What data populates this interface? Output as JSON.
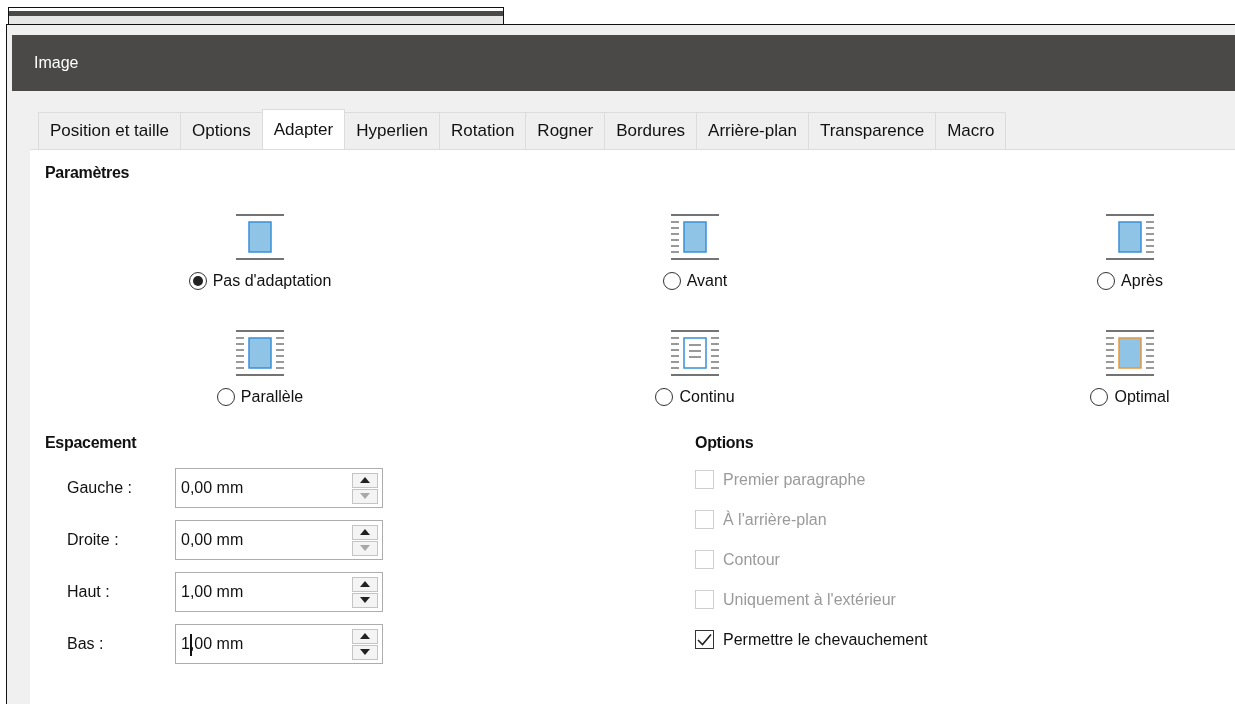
{
  "window": {
    "title": "Image"
  },
  "tabs": [
    {
      "label": "Position et taille",
      "selected": false
    },
    {
      "label": "Options",
      "selected": false
    },
    {
      "label": "Adapter",
      "selected": true
    },
    {
      "label": "Hyperlien",
      "selected": false
    },
    {
      "label": "Rotation",
      "selected": false
    },
    {
      "label": "Rogner",
      "selected": false
    },
    {
      "label": "Bordures",
      "selected": false
    },
    {
      "label": "Arrière-plan",
      "selected": false
    },
    {
      "label": "Transparence",
      "selected": false
    },
    {
      "label": "Macro",
      "selected": false
    }
  ],
  "settings": {
    "heading": "Paramètres",
    "modes": [
      {
        "label": "Pas d'adaptation",
        "kind": "none",
        "selected": true
      },
      {
        "label": "Avant",
        "kind": "before",
        "selected": false
      },
      {
        "label": "Après",
        "kind": "after",
        "selected": false
      },
      {
        "label": "Parallèle",
        "kind": "parallel",
        "selected": false
      },
      {
        "label": "Continu",
        "kind": "through",
        "selected": false
      },
      {
        "label": "Optimal",
        "kind": "optimal",
        "selected": false
      }
    ]
  },
  "spacing": {
    "heading": "Espacement",
    "fields": [
      {
        "label": "Gauche :",
        "value": "0,00 mm",
        "down_disabled": true,
        "focused": false
      },
      {
        "label": "Droite :",
        "value": "0,00 mm",
        "down_disabled": true,
        "focused": false
      },
      {
        "label": "Haut :",
        "value": "1,00 mm",
        "down_disabled": false,
        "focused": false
      },
      {
        "label": "Bas :",
        "value": "1,00 mm",
        "down_disabled": false,
        "focused": true
      }
    ]
  },
  "options": {
    "heading": "Options",
    "items": [
      {
        "label": "Premier paragraphe",
        "checked": false,
        "disabled": true
      },
      {
        "label": "À l'arrière-plan",
        "checked": false,
        "disabled": true
      },
      {
        "label": "Contour",
        "checked": false,
        "disabled": true
      },
      {
        "label": "Uniquement à l'extérieur",
        "checked": false,
        "disabled": true
      },
      {
        "label": "Permettre le chevauchement",
        "checked": true,
        "disabled": false
      }
    ]
  }
}
